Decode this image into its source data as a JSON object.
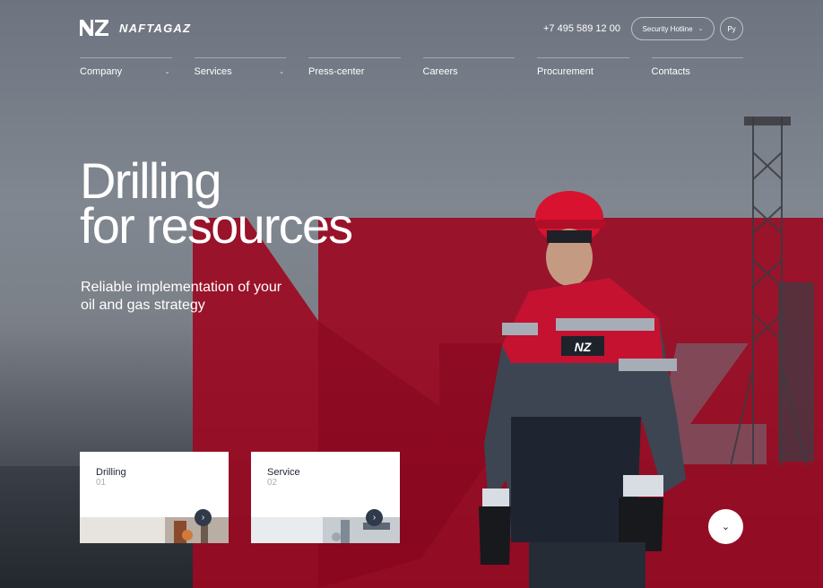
{
  "header": {
    "logo_mark": "NZ",
    "logo_text": "NAFTAGAZ",
    "phone": "+7 495 589 12 00",
    "hotline_label": "Security Hotline",
    "lang_label": "Ру"
  },
  "nav": {
    "items": [
      {
        "label": "Company",
        "has_dropdown": true
      },
      {
        "label": "Services",
        "has_dropdown": true
      },
      {
        "label": "Press-center",
        "has_dropdown": false
      },
      {
        "label": "Careers",
        "has_dropdown": false
      },
      {
        "label": "Procurement",
        "has_dropdown": false
      },
      {
        "label": "Contacts",
        "has_dropdown": false
      }
    ]
  },
  "hero": {
    "headline_line1": "Drilling",
    "headline_line2": "for resources",
    "subline_line1": "Reliable implementation of your",
    "subline_line2": "oil and gas strategy",
    "jacket_logo": "NZ"
  },
  "cards": [
    {
      "title": "Drilling",
      "number": "01"
    },
    {
      "title": "Service",
      "number": "02"
    }
  ],
  "colors": {
    "brand_red": "#a3001f",
    "card_arrow": "#2f3a4a"
  },
  "icons": {
    "chevron": "chevron-down-icon",
    "arrow": "chevron-right-icon"
  }
}
